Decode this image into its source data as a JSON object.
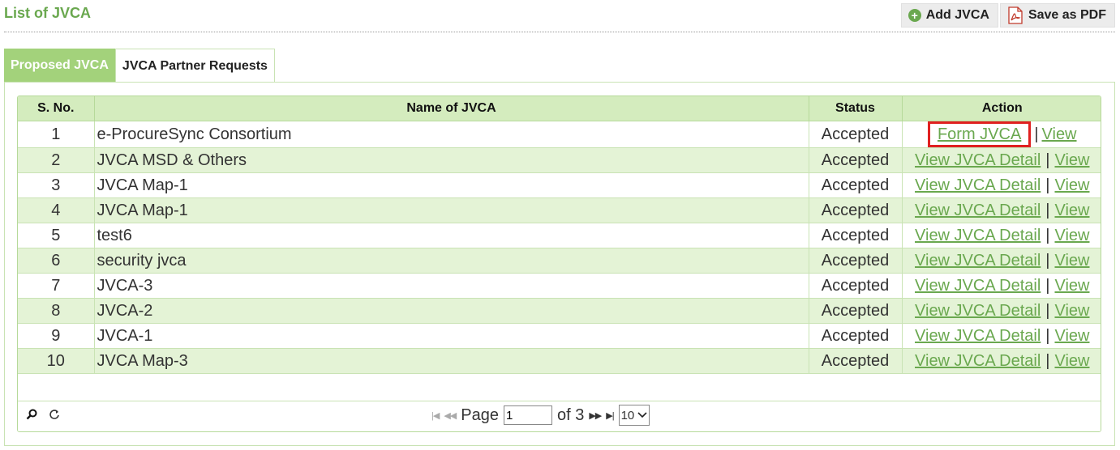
{
  "page": {
    "title": "List of JVCA"
  },
  "toolbar": {
    "add_label": "Add JVCA",
    "pdf_label": "Save as PDF"
  },
  "tabs": [
    {
      "label": "Proposed JVCA",
      "active": true
    },
    {
      "label": "JVCA Partner Requests",
      "active": false
    }
  ],
  "table": {
    "headers": [
      "S. No.",
      "Name of JVCA",
      "Status",
      "Action"
    ],
    "rows": [
      {
        "sno": "1",
        "name": "e-ProcureSync Consortium",
        "status": "Accepted",
        "action1": "Form JVCA",
        "sep": "|",
        "action2": "View"
      },
      {
        "sno": "2",
        "name": "JVCA MSD & Others",
        "status": "Accepted",
        "action1": "View JVCA Detail",
        "sep": "|",
        "action2": "View"
      },
      {
        "sno": "3",
        "name": "JVCA Map-1",
        "status": "Accepted",
        "action1": "View JVCA Detail",
        "sep": "|",
        "action2": "View"
      },
      {
        "sno": "4",
        "name": "JVCA Map-1",
        "status": "Accepted",
        "action1": "View JVCA Detail",
        "sep": "|",
        "action2": "View"
      },
      {
        "sno": "5",
        "name": "test6",
        "status": "Accepted",
        "action1": "View JVCA Detail",
        "sep": "|",
        "action2": "View"
      },
      {
        "sno": "6",
        "name": "security jvca",
        "status": "Accepted",
        "action1": "View JVCA Detail",
        "sep": "|",
        "action2": "View"
      },
      {
        "sno": "7",
        "name": "JVCA-3",
        "status": "Accepted",
        "action1": "View JVCA Detail",
        "sep": "|",
        "action2": "View"
      },
      {
        "sno": "8",
        "name": "JVCA-2",
        "status": "Accepted",
        "action1": "View JVCA Detail",
        "sep": "|",
        "action2": "View"
      },
      {
        "sno": "9",
        "name": "JVCA-1",
        "status": "Accepted",
        "action1": "View JVCA Detail",
        "sep": "|",
        "action2": "View"
      },
      {
        "sno": "10",
        "name": "JVCA Map-3",
        "status": "Accepted",
        "action1": "View JVCA Detail",
        "sep": "|",
        "action2": "View"
      }
    ]
  },
  "pager": {
    "page_label": "Page",
    "current_page": "1",
    "of_label": "of 3",
    "page_size": "10",
    "search_icon": "search-icon",
    "refresh_icon": "refresh-icon"
  },
  "colors": {
    "accent": "#6aa84f",
    "header_bg": "#d4ecbe",
    "row_alt": "#e4f3d6",
    "highlight": "#e02020"
  }
}
